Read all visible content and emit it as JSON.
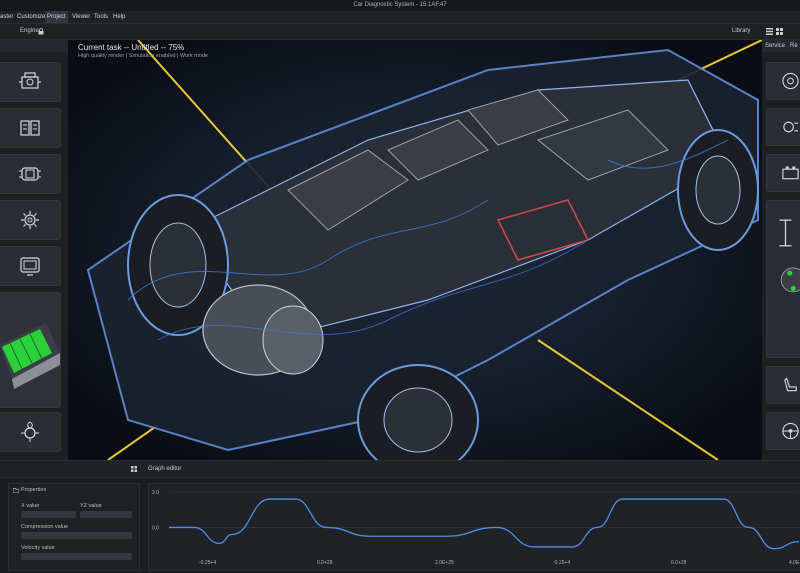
{
  "window": {
    "title": "Car Diagnostic System - 15.1AF.47"
  },
  "menu": [
    {
      "label": "aster"
    },
    {
      "label": "Customize"
    },
    {
      "label": "Project",
      "active": true
    },
    {
      "label": "Viewer"
    },
    {
      "label": "Tools"
    },
    {
      "label": "Help"
    }
  ],
  "toolbar": {
    "engine_label": "Engine",
    "library_label": "Library"
  },
  "viewport": {
    "title": "Current task -- Untitled -- 75%",
    "subtitle": "High quality render | Simulation enabled | Work mode"
  },
  "right_panel": {
    "header": "Service",
    "extra": "Re"
  },
  "left_tiles": [
    {
      "icon": "engine-block-icon"
    },
    {
      "icon": "battery-modules-icon"
    },
    {
      "icon": "car-top-view-icon"
    },
    {
      "icon": "gear-settings-icon"
    },
    {
      "icon": "dashboard-screen-icon"
    },
    {
      "icon": "battery-pack-thumbnail"
    },
    {
      "icon": "eco-chip-icon"
    }
  ],
  "right_tiles": [
    {
      "icon": "brake-disc-icon"
    },
    {
      "icon": "gear-swap-icon"
    },
    {
      "icon": "car-battery-icon"
    },
    {
      "icon": "chassis-thumbnail"
    },
    {
      "icon": "seat-icon"
    },
    {
      "icon": "steering-wheel-icon"
    }
  ],
  "bottom": {
    "tab_label": "Graph editor",
    "properties_title": "Properties",
    "props": {
      "x_value": "X value",
      "yz_value": "YZ value",
      "compression_value": "Compression value",
      "velocity_value": "Velocity value"
    }
  },
  "chart_data": {
    "type": "line",
    "title": "",
    "xlabel": "",
    "ylabel": "",
    "y_ticks": [
      "2.0",
      "0.0"
    ],
    "x_ticks": [
      "-0.25+4",
      "0.0+28",
      "2.0E+25",
      "-0.25+4",
      "0.0+28",
      "4.0E+25"
    ],
    "ylim": [
      -1.5,
      2.0
    ],
    "x": [
      0,
      4,
      8,
      10,
      16,
      20,
      25,
      32,
      44,
      52,
      58,
      64,
      68,
      72,
      76,
      80,
      88,
      92,
      96,
      100
    ],
    "values": [
      0.0,
      0.0,
      -0.9,
      -0.4,
      1.6,
      1.6,
      0.0,
      -0.5,
      -0.5,
      0.0,
      -1.1,
      -1.1,
      0.0,
      1.6,
      1.6,
      1.6,
      1.6,
      0.0,
      -1.2,
      -0.8
    ]
  }
}
